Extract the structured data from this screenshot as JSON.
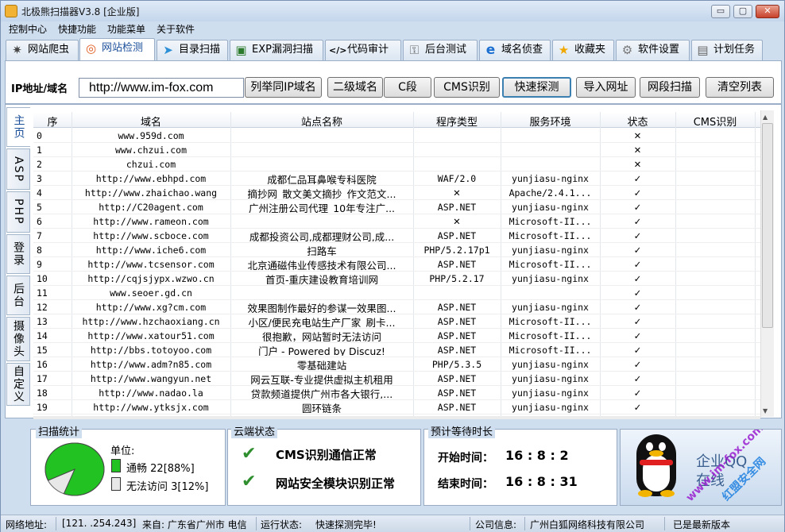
{
  "window": {
    "title": "北极熊扫描器V3.8 [企业版]",
    "min": "▭",
    "max": "▢",
    "close": "✕"
  },
  "menu": [
    "控制中心",
    "快捷功能",
    "功能菜单",
    "关于软件"
  ],
  "tabs": [
    {
      "label": "网站爬虫",
      "icon": "spider-icon",
      "glyph": "✷"
    },
    {
      "label": "网站检测",
      "icon": "target-icon",
      "glyph": "◎"
    },
    {
      "label": "目录扫描",
      "icon": "telegram-icon",
      "glyph": "➤"
    },
    {
      "label": "EXP漏洞扫描",
      "icon": "terminal-icon",
      "glyph": "▣"
    },
    {
      "label": "代码审计",
      "icon": "code-icon",
      "glyph": "</>"
    },
    {
      "label": "后台测试",
      "icon": "key-icon",
      "glyph": "⚿"
    },
    {
      "label": "域名侦查",
      "icon": "ie-icon",
      "glyph": "e"
    },
    {
      "label": "收藏夹",
      "icon": "star-icon",
      "glyph": "★"
    },
    {
      "label": "软件设置",
      "icon": "gear-icon",
      "glyph": "⚙"
    },
    {
      "label": "计划任务",
      "icon": "clipboard-icon",
      "glyph": "▤"
    }
  ],
  "toolbar": {
    "ip_label": "IP地址/域名",
    "url_value": "http://www.im-fox.com",
    "buttons": [
      "列举同IP域名",
      "二级域名",
      "C段",
      "CMS识别",
      "快速探测",
      "导入网址",
      "网段扫描",
      "清空列表"
    ]
  },
  "side_tabs": [
    "主页",
    "ASP",
    "PHP",
    "登录",
    "后台",
    "摄像头",
    "自定义"
  ],
  "table": {
    "headers": [
      "序",
      "域名",
      "站点名称",
      "程序类型",
      "服务环境",
      "状态",
      "CMS识别"
    ],
    "rows": [
      [
        "0",
        "www.959d.com",
        "",
        "",
        "",
        "✕",
        ""
      ],
      [
        "1",
        "www.chzui.com",
        "",
        "",
        "",
        "✕",
        ""
      ],
      [
        "2",
        "chzui.com",
        "",
        "",
        "",
        "✕",
        ""
      ],
      [
        "3",
        "http://www.ebhpd.com",
        "成都仁品耳鼻喉专科医院",
        "WAF/2.0",
        "yunjiasu-nginx",
        "✓",
        ""
      ],
      [
        "4",
        "http://www.zhaichao.wang",
        "摘抄网_散文美文摘抄_作文范文...",
        "✕",
        "Apache/2.4.1...",
        "✓",
        ""
      ],
      [
        "5",
        "http://C20agent.com",
        "广州注册公司代理_10年专注广...",
        "ASP.NET",
        "yunjiasu-nginx",
        "✓",
        ""
      ],
      [
        "6",
        "http://www.rameon.com",
        "",
        "✕",
        "Microsoft-II...",
        "✓",
        ""
      ],
      [
        "7",
        "http://www.scboce.com",
        "成都投资公司,成都理财公司,成...",
        "ASP.NET",
        "Microsoft-II...",
        "✓",
        ""
      ],
      [
        "8",
        "http://www.iche6.com",
        "扫路车",
        "PHP/5.2.17p1",
        "yunjiasu-nginx",
        "✓",
        ""
      ],
      [
        "9",
        "http://www.tcsensor.com",
        "北京通磁伟业传感技术有限公司...",
        "ASP.NET",
        "Microsoft-II...",
        "✓",
        ""
      ],
      [
        "10",
        "http://cqjsjypx.wzwo.cn",
        "首页-重庆建设教育培训网",
        "PHP/5.2.17",
        "yunjiasu-nginx",
        "✓",
        ""
      ],
      [
        "11",
        "www.seoer.gd.cn",
        "",
        "",
        "",
        "✓",
        ""
      ],
      [
        "12",
        "http://www.xg?cm.com",
        "效果图制作最好的参谋一效果图...",
        "ASP.NET",
        "yunjiasu-nginx",
        "✓",
        ""
      ],
      [
        "13",
        "http://www.hzchaoxiang.cn",
        "小区/便民充电站生产厂家_刷卡...",
        "ASP.NET",
        "Microsoft-II...",
        "✓",
        ""
      ],
      [
        "14",
        "http://www.xatour51.com",
        "很抱歉，网站暂时无法访问",
        "ASP.NET",
        "Microsoft-II...",
        "✓",
        ""
      ],
      [
        "15",
        "http://bbs.totoyoo.com",
        "门户 -  Powered by Discuz!",
        "ASP.NET",
        "Microsoft-II...",
        "✓",
        ""
      ],
      [
        "16",
        "http://www.adm?n85.com",
        "零基础建站",
        "PHP/5.3.5",
        "yunjiasu-nginx",
        "✓",
        ""
      ],
      [
        "17",
        "http://www.wangyun.net",
        "网云互联-专业提供虚拟主机租用",
        "ASP.NET",
        "yunjiasu-nginx",
        "✓",
        ""
      ],
      [
        "18",
        "http://www.nadao.la",
        "贷款频道提供广州市各大银行,...",
        "ASP.NET",
        "yunjiasu-nginx",
        "✓",
        ""
      ],
      [
        "19",
        "http://www.ytksjx.com",
        "圆环链条",
        "ASP.NET",
        "yunjiasu-nginx",
        "✓",
        ""
      ]
    ]
  },
  "stats": {
    "title": "扫描统计",
    "unit": "单位:",
    "ok_label": "通畅",
    "ok_value": "22[88%]",
    "fail_label": "无法访问",
    "fail_value": "3[12%]",
    "ok_fraction": 0.88,
    "ok_color": "#22c222",
    "fail_color": "#e8e8e8"
  },
  "cloud": {
    "title": "云端状态",
    "items": [
      "CMS识别通信正常",
      "网站安全模块识别正常"
    ]
  },
  "timer": {
    "title": "预计等待时长",
    "start_label": "开始时间：",
    "start_value": "16 : 8 : 2",
    "end_label": "结束时间：",
    "end_value": "16 : 8 : 31"
  },
  "promo": {
    "line1": "企业QQ",
    "line2": "在线",
    "watermark1": "www.im-fox.com",
    "watermark2": "红盟安全网"
  },
  "statusbar": {
    "net_label": "网络地址:",
    "ip": "[121.  .254.243]",
    "from": "来自: 广东省广州市 电信",
    "run_label": "运行状态:",
    "run_value": "快速探测完毕!",
    "company_label": "公司信息:",
    "company": "广州白狐网络科技有限公司",
    "version": "已是最新版本"
  }
}
